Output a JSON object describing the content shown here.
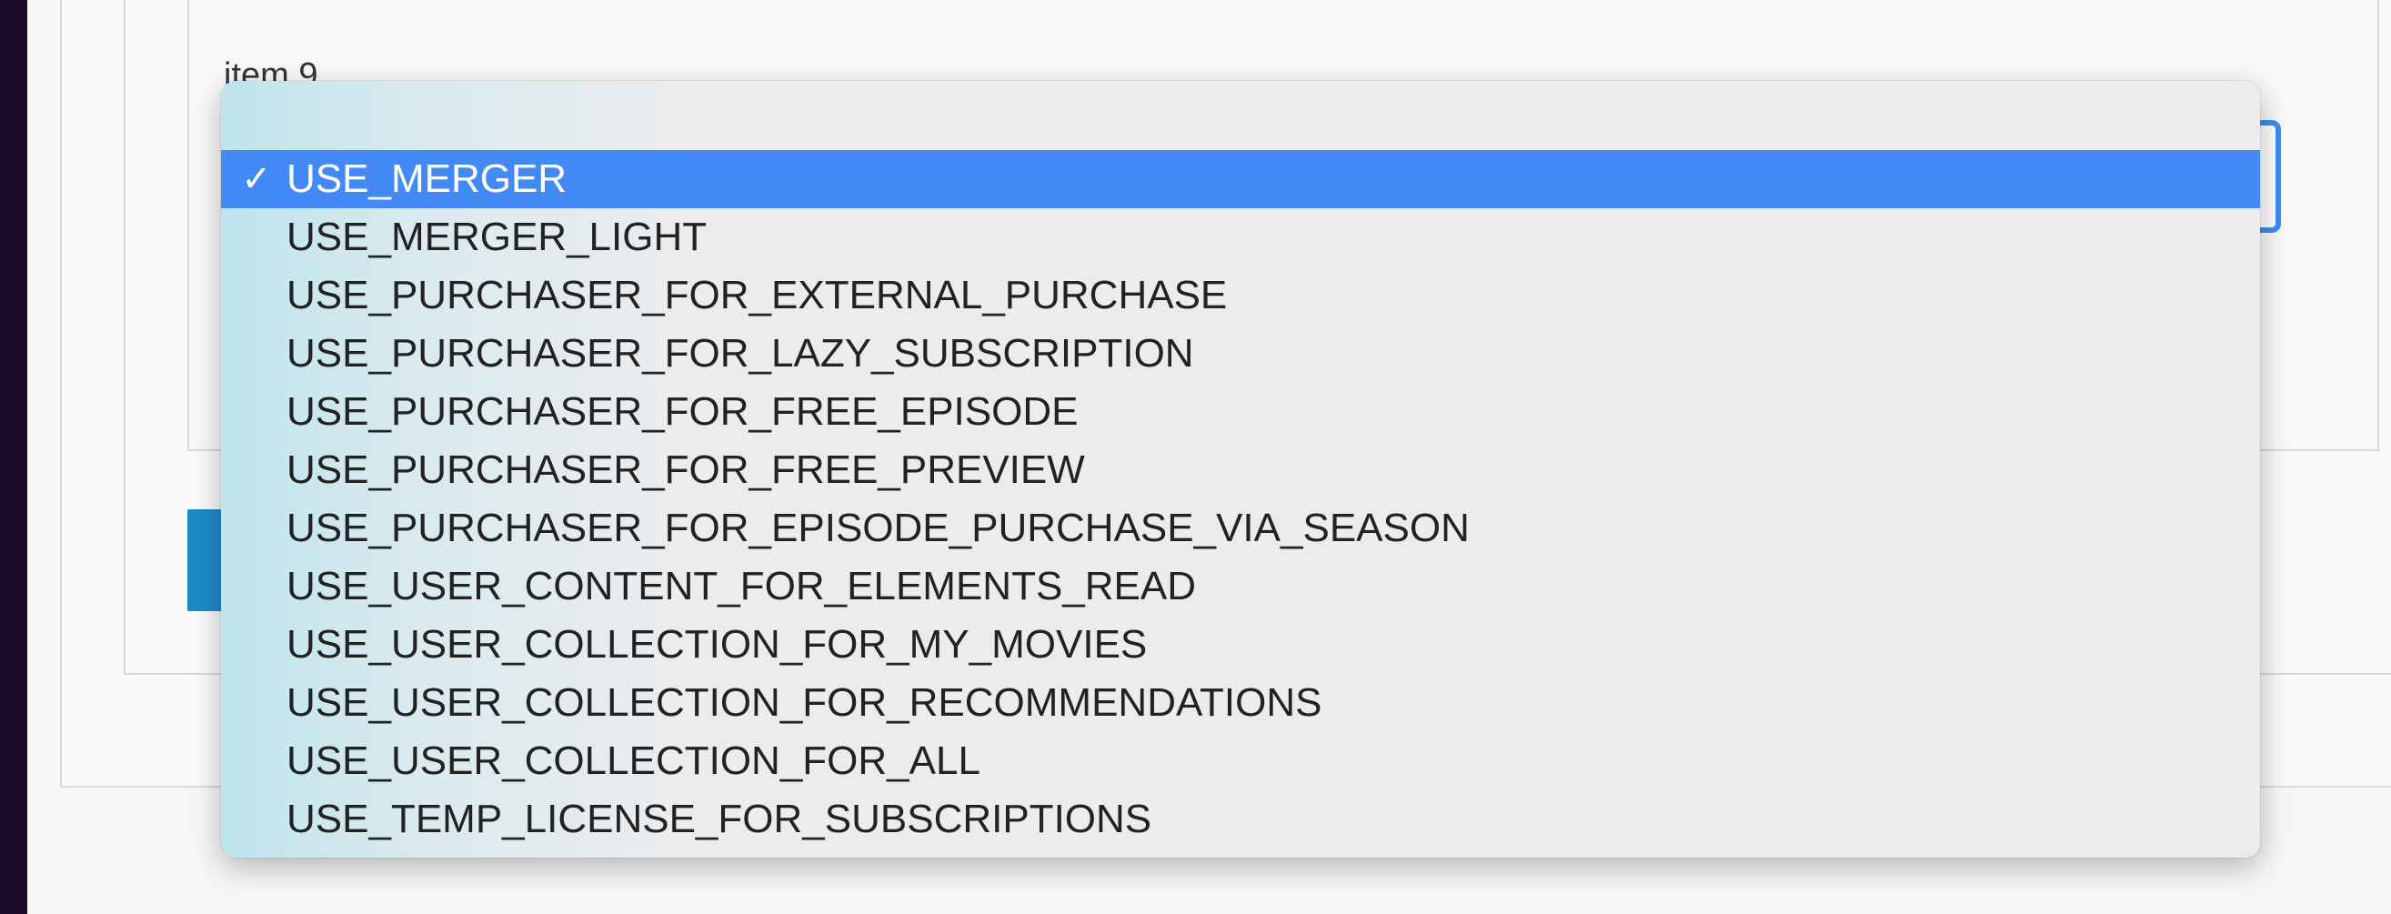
{
  "form": {
    "field_label": "item 9"
  },
  "dropdown": {
    "selected_index": 0,
    "checkmark_icon": "checkmark-icon",
    "checkmark_glyph": "✓",
    "options": [
      "USE_MERGER",
      "USE_MERGER_LIGHT",
      "USE_PURCHASER_FOR_EXTERNAL_PURCHASE",
      "USE_PURCHASER_FOR_LAZY_SUBSCRIPTION",
      "USE_PURCHASER_FOR_FREE_EPISODE",
      "USE_PURCHASER_FOR_FREE_PREVIEW",
      "USE_PURCHASER_FOR_EPISODE_PURCHASE_VIA_SEASON",
      "USE_USER_CONTENT_FOR_ELEMENTS_READ",
      "USE_USER_COLLECTION_FOR_MY_MOVIES",
      "USE_USER_COLLECTION_FOR_RECOMMENDATIONS",
      "USE_USER_COLLECTION_FOR_ALL",
      "USE_TEMP_LICENSE_FOR_SUBSCRIPTIONS"
    ]
  },
  "colors": {
    "selected_background": "#438af6",
    "focus_border": "#3c8df0",
    "button_background": "#1c8bc8",
    "window_background": "#1c0c2a"
  }
}
